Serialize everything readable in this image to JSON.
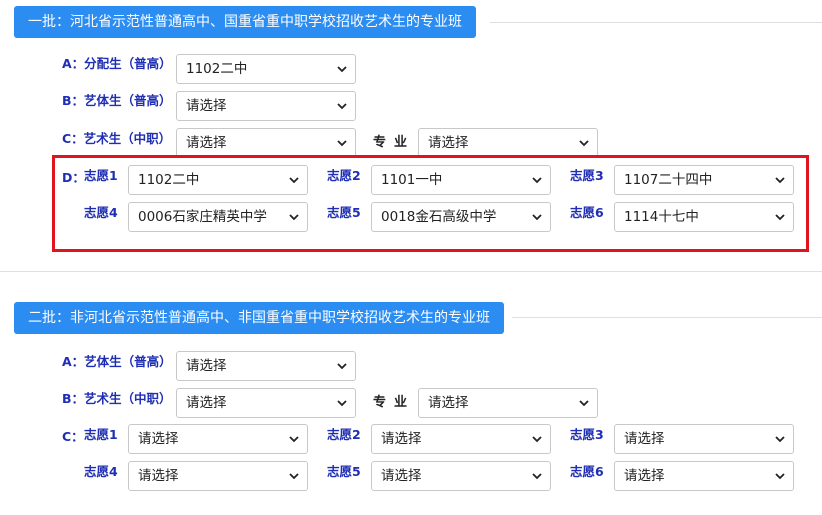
{
  "batch1": {
    "title": "一批：河北省示范性普通高中、国重省重中职学校招收艺术生的专业班",
    "a_label": "A：分配生（普高）",
    "a_value": "1102二中",
    "b_label": "B：艺体生（普高）",
    "b_value": "请选择",
    "c_label": "C：艺术生（中职）",
    "c_value": "请选择",
    "major_label": "专业",
    "major_value": "请选择",
    "d_prefix": "D：",
    "wishes": [
      {
        "label": "志愿1",
        "value": "1102二中"
      },
      {
        "label": "志愿2",
        "value": "1101一中"
      },
      {
        "label": "志愿3",
        "value": "1107二十四中"
      },
      {
        "label": "志愿4",
        "value": "0006石家庄精英中学"
      },
      {
        "label": "志愿5",
        "value": "0018金石高级中学"
      },
      {
        "label": "志愿6",
        "value": "1114十七中"
      }
    ]
  },
  "batch2": {
    "title": "二批：非河北省示范性普通高中、非国重省重中职学校招收艺术生的专业班",
    "a_label": "A：艺体生（普高）",
    "a_value": "请选择",
    "b_label": "B：艺术生（中职）",
    "b_value": "请选择",
    "major_label": "专业",
    "major_value": "请选择",
    "c_prefix": "C：",
    "wishes": [
      {
        "label": "志愿1",
        "value": "请选择"
      },
      {
        "label": "志愿2",
        "value": "请选择"
      },
      {
        "label": "志愿3",
        "value": "请选择"
      },
      {
        "label": "志愿4",
        "value": "请选择"
      },
      {
        "label": "志愿5",
        "value": "请选择"
      },
      {
        "label": "志愿6",
        "value": "请选择"
      }
    ]
  },
  "icons": {
    "dropdown": "chevron-down-icon"
  },
  "colors": {
    "accent": "#2b8cf1",
    "label": "#1f2eb4",
    "highlight": "#e0141e"
  }
}
